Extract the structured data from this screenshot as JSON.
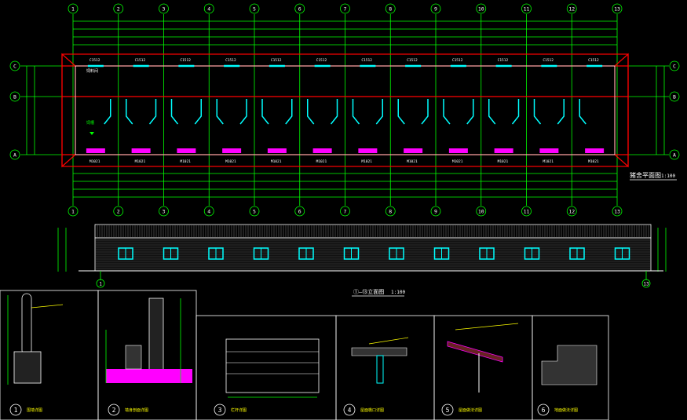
{
  "plan": {
    "title": "猪舍平面图",
    "scale": "1:100",
    "axis_numbers": [
      "1",
      "2",
      "3",
      "4",
      "5",
      "6",
      "7",
      "8",
      "9",
      "10",
      "11",
      "12",
      "13"
    ],
    "axis_letters": [
      "C",
      "B",
      "A"
    ],
    "room_label": "饲料间",
    "window_tag": "C1512",
    "door_tag": "M1021"
  },
  "elevation": {
    "title": "①—⑬立面图",
    "scale": "1:100",
    "start_axis": "1",
    "end_axis": "13"
  },
  "details": {
    "numbers": [
      "1",
      "2",
      "3",
      "4",
      "5",
      "6"
    ],
    "labels": [
      "围墙详图",
      "墙身剖面详图",
      "栏杆详图",
      "屋面檐口详图",
      "屋面做法详图",
      "地面做法详图"
    ]
  }
}
